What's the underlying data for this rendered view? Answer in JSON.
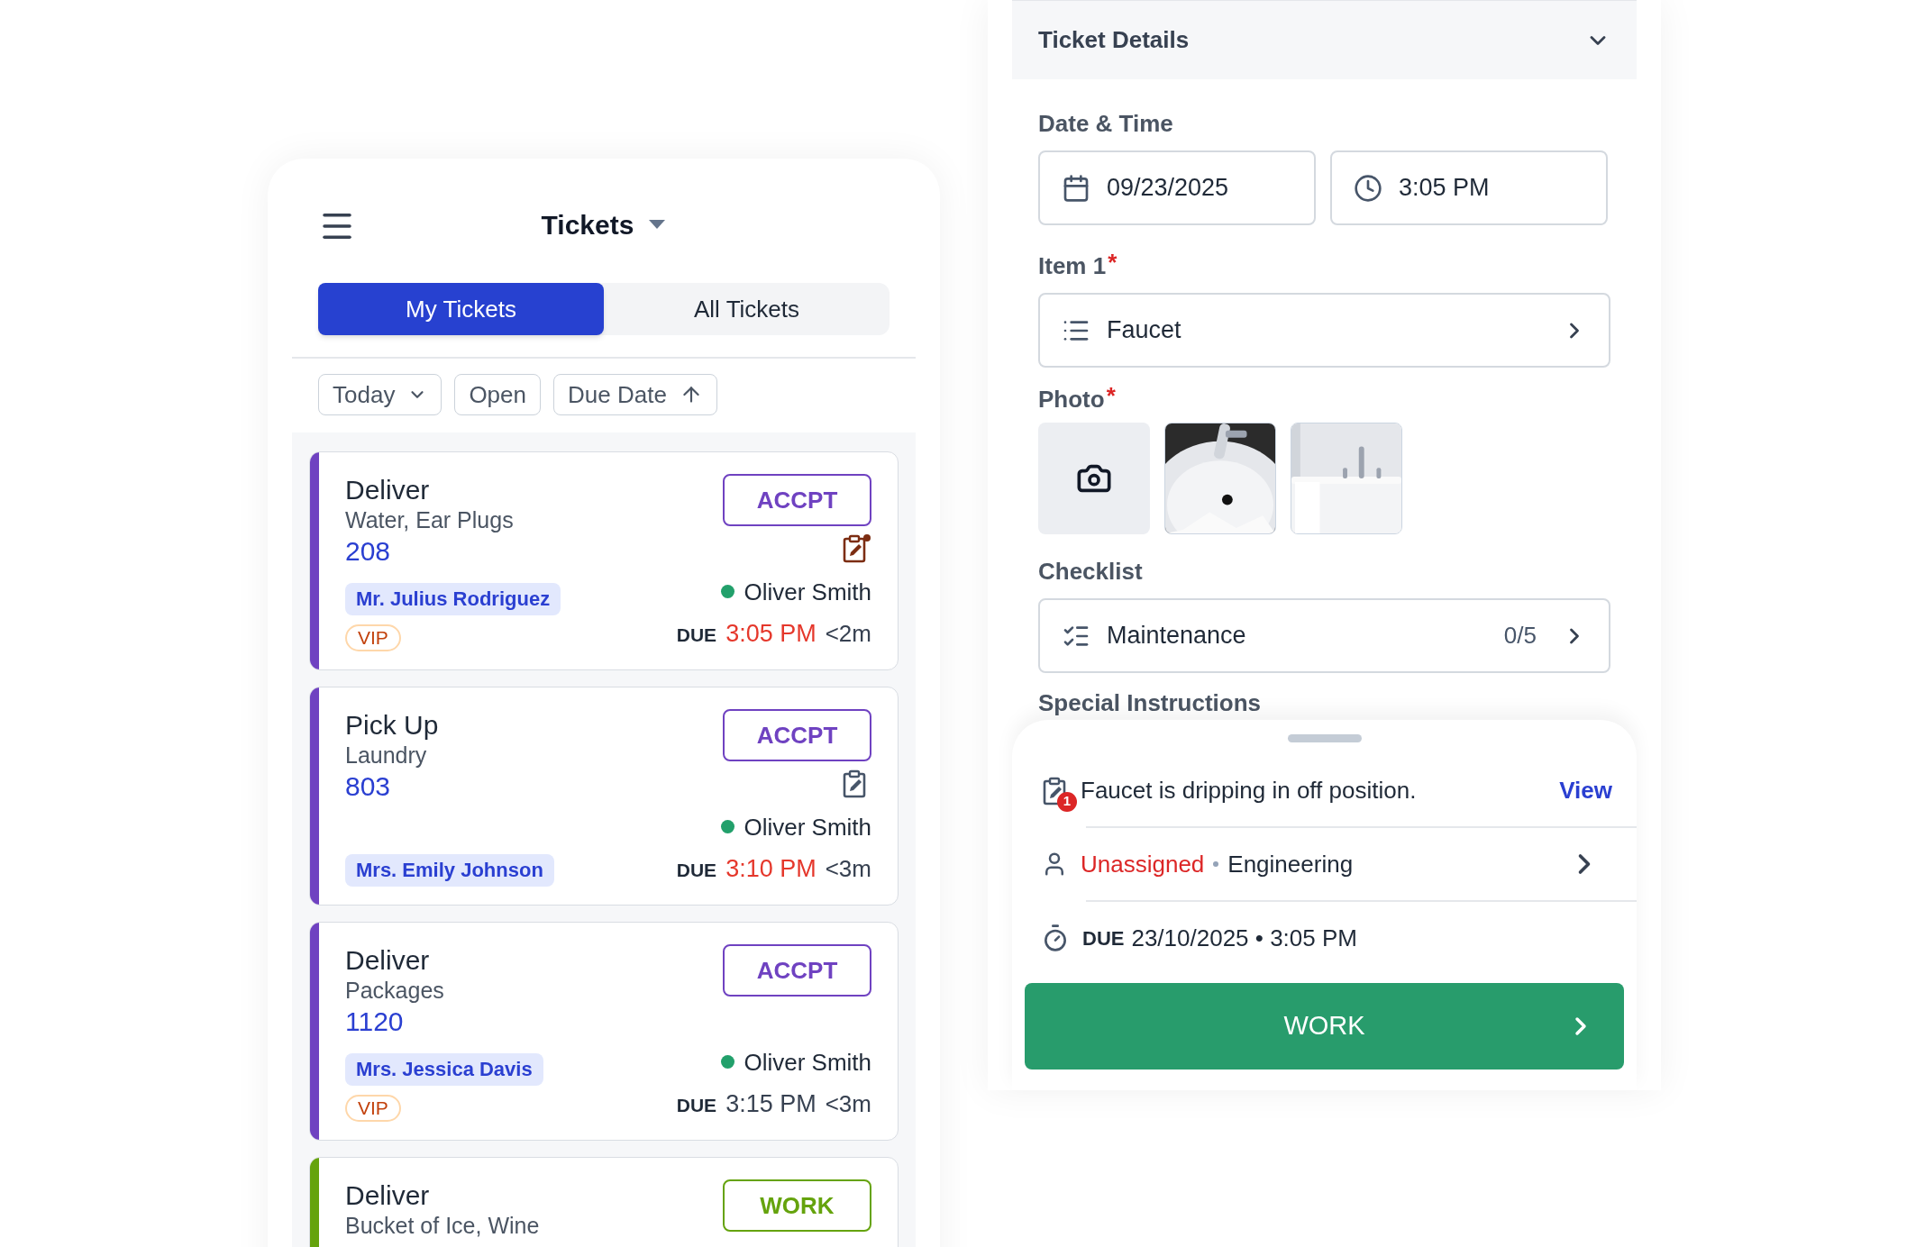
{
  "tickets_screen": {
    "title": "Tickets",
    "tabs": [
      {
        "label": "My Tickets",
        "selected": true
      },
      {
        "label": "All Tickets",
        "selected": false
      }
    ],
    "filters": [
      {
        "label": "Today",
        "kind": "dropdown"
      },
      {
        "label": "Open",
        "kind": "plain"
      },
      {
        "label": "Due Date",
        "kind": "sort"
      }
    ],
    "tickets": [
      {
        "action": "Deliver",
        "items": "Water, Ear Plugs",
        "room": "208",
        "guest": "Mr. Julius Rodriguez",
        "badge": "VIP",
        "button": "ACCPT",
        "color": "#6f42c1",
        "note": {
          "flagged": true
        },
        "assignee": "Oliver Smith",
        "due_label": "DUE",
        "due_time": "3:05 PM",
        "overdue": true,
        "eta": "<2m"
      },
      {
        "action": "Pick Up",
        "items": "Laundry",
        "room": "803",
        "guest": "Mrs. Emily Johnson",
        "button": "ACCPT",
        "color": "#6f42c1",
        "note": {
          "flagged": false
        },
        "assignee": "Oliver Smith",
        "due_label": "DUE",
        "due_time": "3:10 PM",
        "overdue": true,
        "eta": "<3m"
      },
      {
        "action": "Deliver",
        "items": "Packages",
        "room": "1120",
        "guest": "Mrs. Jessica Davis",
        "badge": "VIP",
        "button": "ACCPT",
        "color": "#6f42c1",
        "assignee": "Oliver Smith",
        "due_label": "DUE",
        "due_time": "3:15 PM",
        "overdue": false,
        "eta": "<3m"
      },
      {
        "action": "Deliver",
        "items": "Bucket of Ice, Wine",
        "button": "WORK",
        "color": "#65a30d"
      }
    ]
  },
  "ticket_details": {
    "title": "Ticket Details",
    "date_time": {
      "label": "Date & Time",
      "date": "09/23/2025",
      "time": "3:05 PM"
    },
    "item": {
      "label": "Item 1",
      "required_mark": "*",
      "value": "Faucet"
    },
    "photo": {
      "label": "Photo",
      "required_mark": "*",
      "tiles": [
        {
          "kind": "camera"
        },
        {
          "kind": "picture"
        },
        {
          "kind": "picture"
        }
      ]
    },
    "checklist": {
      "label": "Checklist",
      "value": "Maintenance",
      "count": "0/5"
    },
    "special_instructions": {
      "label": "Special Instructions"
    },
    "sheet": {
      "note": "Faucet is dripping in off position.",
      "note_count": "1",
      "link": "View",
      "assignment": "Unassigned",
      "department": "Engineering",
      "due_label": "DUE",
      "due": "23/10/2025 • 3:05 PM",
      "button": "WORK"
    }
  }
}
